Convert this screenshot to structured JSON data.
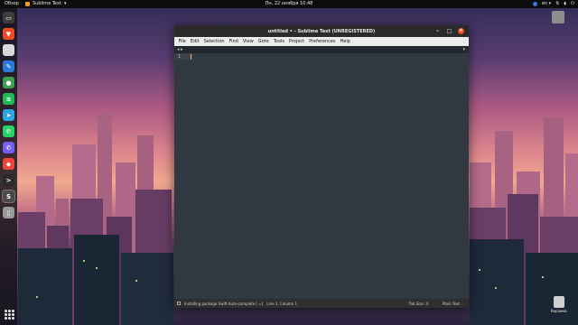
{
  "topbar": {
    "activities": "Обзор",
    "app_name": "Sublime Text",
    "clock": "Пн, 22 ноября  10:48",
    "keyboard": "en",
    "network_icon": "network-icon",
    "volume_icon": "volume-icon",
    "power_icon": "power-icon"
  },
  "dock": {
    "items": [
      {
        "name": "files",
        "color": "#3d3d3d",
        "glyph": "▭"
      },
      {
        "name": "brave",
        "color": "#f04a22",
        "glyph": "▼"
      },
      {
        "name": "libreoffice",
        "color": "#d9d9d9",
        "glyph": ""
      },
      {
        "name": "editor",
        "color": "#2b7bd6",
        "glyph": "✎"
      },
      {
        "name": "green-app",
        "color": "#3f9f55",
        "glyph": "●"
      },
      {
        "name": "spotify",
        "color": "#1db954",
        "glyph": "≋"
      },
      {
        "name": "telegram",
        "color": "#2ca5e0",
        "glyph": "➤"
      },
      {
        "name": "whatsapp",
        "color": "#25d366",
        "glyph": "✆"
      },
      {
        "name": "viber",
        "color": "#7360f2",
        "glyph": "✆"
      },
      {
        "name": "anydesk",
        "color": "#ef443b",
        "glyph": "◆"
      },
      {
        "name": "terminal",
        "color": "#2b2b2b",
        "glyph": ">"
      },
      {
        "name": "sublime-text",
        "color": "#4a4a4a",
        "glyph": "S",
        "active": true
      },
      {
        "name": "trash",
        "color": "#9a9a9a",
        "glyph": "▯"
      }
    ]
  },
  "desktop": {
    "home_label": "",
    "trash_label": "Корзина"
  },
  "window": {
    "title": "untitled • - Sublime Text (UNREGISTERED)",
    "menu": [
      "File",
      "Edit",
      "Selection",
      "Find",
      "View",
      "Goto",
      "Tools",
      "Project",
      "Preferences",
      "Help"
    ],
    "nav_arrows": "◂ ▸",
    "tab_dropdown": "▾",
    "line_number": "1",
    "status": {
      "message": "Installing package Swift Auto-complete [  =]",
      "position": "Line 1, Column 1",
      "tab_size": "Tab Size: 4",
      "syntax": "Plain Text"
    }
  }
}
